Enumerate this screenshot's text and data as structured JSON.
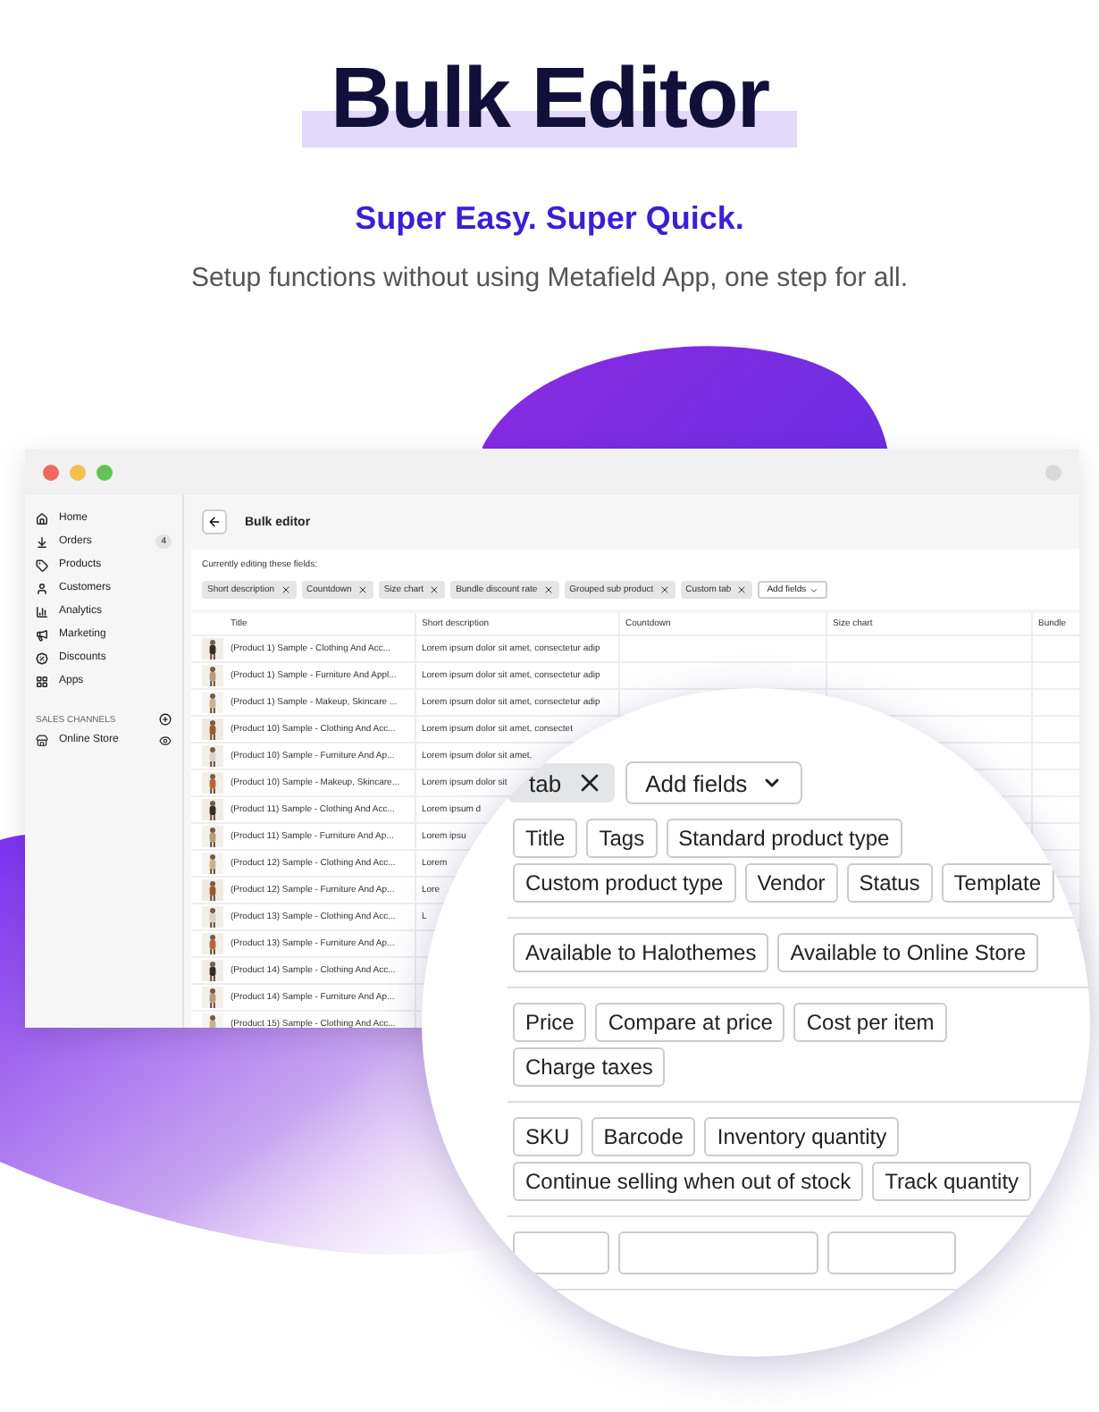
{
  "hero": {
    "title": "Bulk Editor",
    "tagline": "Super Easy. Super Quick.",
    "description": "Setup functions without using Metafield App, one step for all."
  },
  "sidebar": {
    "items": [
      {
        "label": "Home"
      },
      {
        "label": "Orders",
        "badge": "4"
      },
      {
        "label": "Products"
      },
      {
        "label": "Customers"
      },
      {
        "label": "Analytics"
      },
      {
        "label": "Marketing"
      },
      {
        "label": "Discounts"
      },
      {
        "label": "Apps"
      }
    ],
    "section": "SALES CHANNELS",
    "channels": [
      {
        "label": "Online Store"
      }
    ]
  },
  "page": {
    "title": "Bulk editor",
    "editing_label": "Currently editing these fields:",
    "fields": [
      "Short description",
      "Countdown",
      "Size chart",
      "Bundle discount rate",
      "Grouped sub product",
      "Custom tab"
    ],
    "add_button": "Add fields"
  },
  "table": {
    "columns": [
      "Title",
      "Short description",
      "Countdown",
      "Size chart",
      "Bundle"
    ],
    "rows": [
      {
        "title": "(Product 1) Sample - Clothing And Acc...",
        "description": "Lorem ipsum dolor sit amet, consectetur adip"
      },
      {
        "title": "(Product 1) Sample - Furniture And Appl...",
        "description": "Lorem ipsum dolor sit amet, consectetur adip"
      },
      {
        "title": "(Product 1) Sample - Makeup, Skincare ...",
        "description": "Lorem ipsum dolor sit amet, consectetur adip"
      },
      {
        "title": "(Product 10) Sample - Clothing And Acc...",
        "description": "Lorem ipsum dolor sit amet, consectet"
      },
      {
        "title": "(Product 10) Sample - Furniture And Ap...",
        "description": "Lorem ipsum dolor sit amet,"
      },
      {
        "title": "(Product 10) Sample - Makeup, Skincare...",
        "description": "Lorem ipsum dolor sit"
      },
      {
        "title": "(Product 11) Sample - Clothing And Acc...",
        "description": "Lorem ipsum d"
      },
      {
        "title": "(Product 11) Sample - Furniture And Ap...",
        "description": "Lorem ipsu"
      },
      {
        "title": "(Product 12) Sample - Clothing And Acc...",
        "description": "Lorem"
      },
      {
        "title": "(Product 12) Sample - Furniture And Ap...",
        "description": "Lore"
      },
      {
        "title": "(Product 13) Sample - Clothing And Acc...",
        "description": "L"
      },
      {
        "title": "(Product 13) Sample - Furniture And Ap..."
      },
      {
        "title": "(Product 14) Sample - Clothing And Acc..."
      },
      {
        "title": "(Product 14) Sample - Furniture And Ap..."
      },
      {
        "title": "(Product 15) Sample - Clothing And Acc..."
      }
    ]
  },
  "magnifier": {
    "chip": "tab",
    "add_button": "Add fields",
    "groups": [
      [
        "Title",
        "Tags",
        "Standard product type",
        "Custom product type",
        "Vendor",
        "Status",
        "Template"
      ],
      [
        "Available to Halothemes",
        "Available to Online Store"
      ],
      [
        "Price",
        "Compare at price",
        "Cost per item",
        "Charge taxes"
      ],
      [
        "SKU",
        "Barcode",
        "Inventory quantity",
        "Continue selling when out of stock",
        "Track quantity"
      ]
    ]
  }
}
